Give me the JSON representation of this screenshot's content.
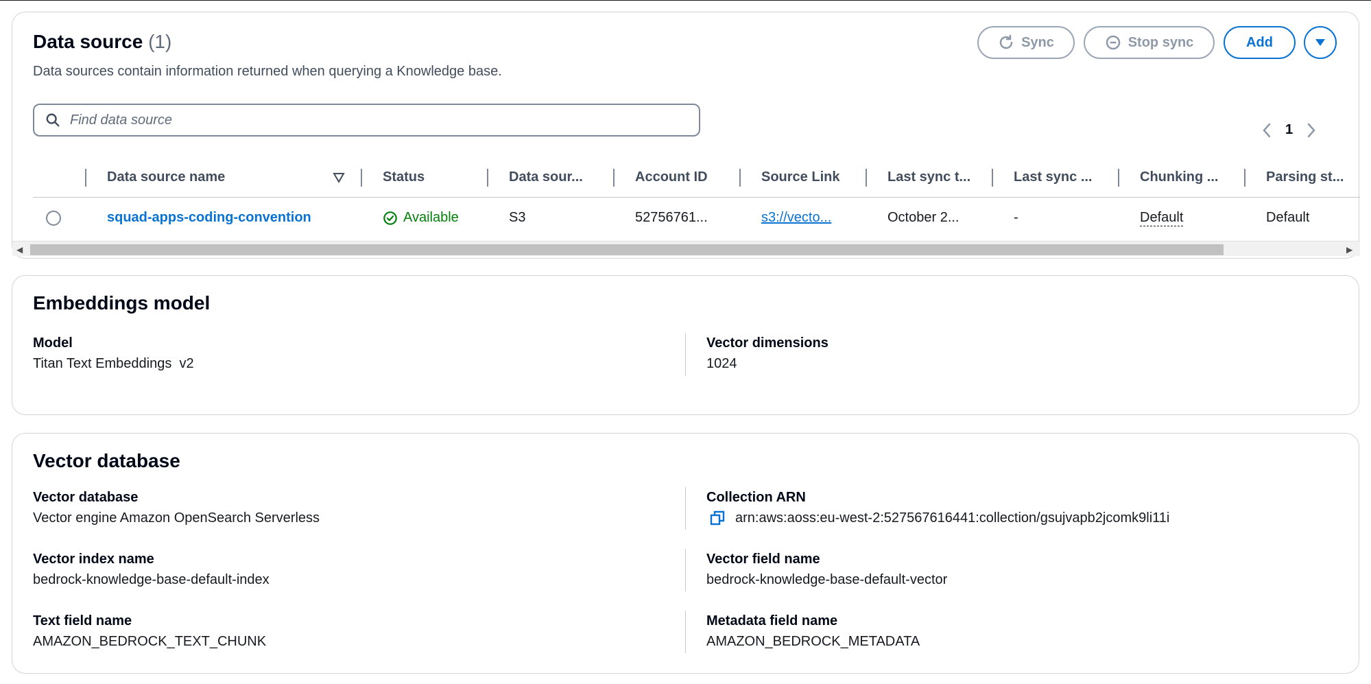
{
  "data_source": {
    "title": "Data source",
    "count": "(1)",
    "description": "Data sources contain information returned when querying a Knowledge base.",
    "buttons": {
      "sync": "Sync",
      "stop_sync": "Stop sync",
      "add": "Add"
    },
    "search": {
      "placeholder": "Find data source",
      "value": ""
    },
    "pagination": {
      "current_page": "1"
    },
    "table": {
      "headers": [
        "Data source name",
        "Status",
        "Data sour...",
        "Account ID",
        "Source Link",
        "Last sync t...",
        "Last sync ...",
        "Chunking ...",
        "Parsing st..."
      ],
      "rows": [
        {
          "name": "squad-apps-coding-convention",
          "status": "Available",
          "data_source_type": "S3",
          "account_id": "52756761...",
          "source_link": "s3://vecto...",
          "last_sync_time": "October 2...",
          "last_sync_status": "-",
          "chunking": "Default",
          "parsing": "Default"
        }
      ]
    }
  },
  "embeddings": {
    "title": "Embeddings model",
    "model_label": "Model",
    "model_value": "Titan Text Embeddings  v2",
    "dimensions_label": "Vector dimensions",
    "dimensions_value": "1024"
  },
  "vector_db": {
    "title": "Vector database",
    "db_label": "Vector database",
    "db_value": "Vector engine Amazon OpenSearch Serverless",
    "arn_label": "Collection ARN",
    "arn_value": "arn:aws:aoss:eu-west-2:527567616441:collection/gsujvapb2jcomk9li11i",
    "index_label": "Vector index name",
    "index_value": "bedrock-knowledge-base-default-index",
    "field_label": "Vector field name",
    "field_value": "bedrock-knowledge-base-default-vector",
    "text_label": "Text field name",
    "text_value": "AMAZON_BEDROCK_TEXT_CHUNK",
    "meta_label": "Metadata field name",
    "meta_value": "AMAZON_BEDROCK_METADATA"
  },
  "icons": {
    "sync": "refresh-icon",
    "stop_sync": "minus-circle-icon",
    "more": "caret-down-icon",
    "search": "search-icon",
    "sort": "sort-descending-icon",
    "status": "check-circle-icon",
    "copy": "copy-icon"
  },
  "colors": {
    "link": "#0972d3",
    "success": "#037f0c",
    "disabled": "#8d99a8",
    "text": "#16191f"
  }
}
